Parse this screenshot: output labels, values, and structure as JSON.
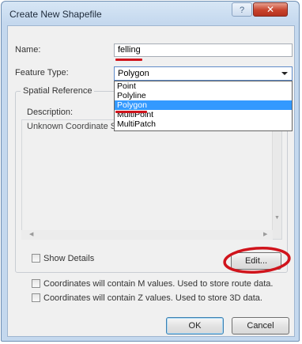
{
  "window": {
    "title": "Create New Shapefile",
    "help_glyph": "?",
    "close_glyph": "✕"
  },
  "form": {
    "name_label": "Name:",
    "name_value": "felling",
    "feature_type_label": "Feature Type:",
    "feature_type_value": "Polygon",
    "feature_type_options": [
      "Point",
      "Polyline",
      "Polygon",
      "MultiPoint",
      "MultiPatch"
    ],
    "feature_type_selected_index": 2
  },
  "spatial_reference": {
    "group_title": "Spatial Reference",
    "description_label": "Description:",
    "description_text": "Unknown Coordinate System",
    "show_details_label": "Show Details",
    "show_details_checked": false,
    "edit_button": "Edit..."
  },
  "options": {
    "m_values_label": "Coordinates will contain M values. Used to store route data.",
    "m_values_checked": false,
    "z_values_label": "Coordinates will contain Z values. Used to store 3D data.",
    "z_values_checked": false
  },
  "buttons": {
    "ok": "OK",
    "cancel": "Cancel"
  },
  "colors": {
    "annotation_red": "#d0141c",
    "selection_blue": "#3399ff",
    "title_bar": "#c4d8ee"
  },
  "icons": {
    "dropdown_arrow": "chevron-down-icon",
    "help": "help-icon",
    "close": "close-icon"
  }
}
